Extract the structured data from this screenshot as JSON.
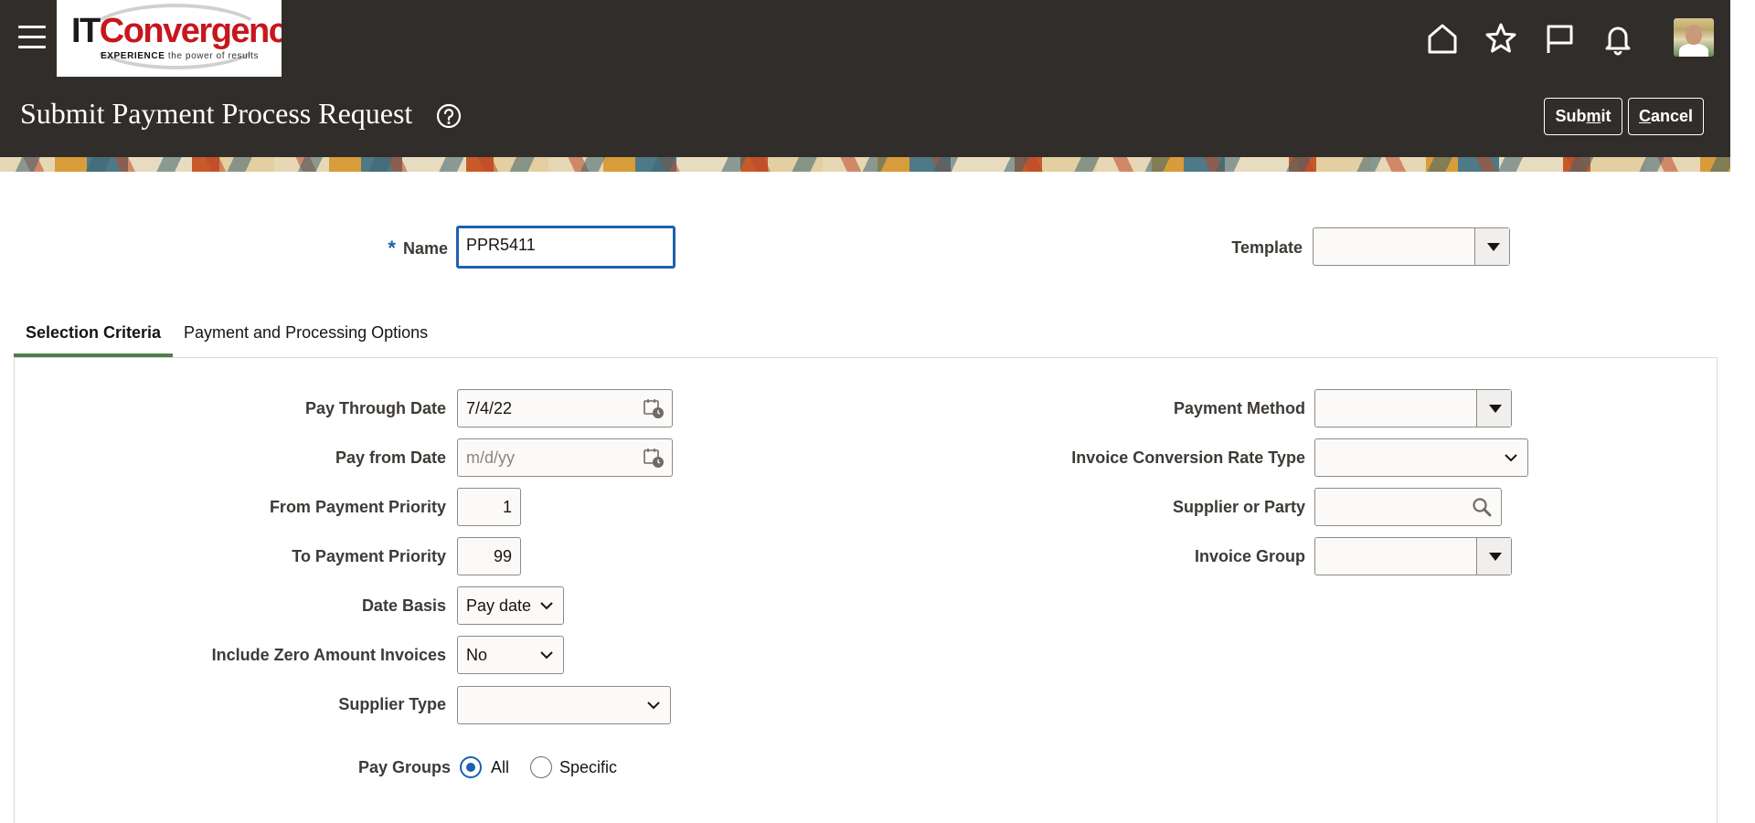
{
  "header": {
    "logo": {
      "brand_it": "IT",
      "brand_rest": "Convergence",
      "tagline_bold": "EXPERIENCE",
      "tagline_rest": " the power of results"
    },
    "icons": [
      "home-icon",
      "favorites-star-icon",
      "flag-icon",
      "notifications-bell-icon"
    ],
    "page_title": "Submit Payment Process Request",
    "buttons": {
      "submit": {
        "pre": "Sub",
        "mnemonic": "m",
        "post": "it"
      },
      "cancel": {
        "pre": "",
        "mnemonic": "C",
        "post": "ancel"
      }
    }
  },
  "form": {
    "name": {
      "required_mark": "*",
      "label": "Name",
      "value": "PPR5411"
    },
    "template": {
      "label": "Template",
      "value": ""
    }
  },
  "tabs": [
    {
      "label": "Selection Criteria",
      "active": true
    },
    {
      "label": "Payment and Processing Options",
      "active": false
    }
  ],
  "selection": {
    "pay_through_date": {
      "label": "Pay Through Date",
      "value": "7/4/22"
    },
    "pay_from_date": {
      "label": "Pay from Date",
      "value": "",
      "placeholder": "m/d/yy"
    },
    "from_priority": {
      "label": "From Payment Priority",
      "value": "1"
    },
    "to_priority": {
      "label": "To Payment Priority",
      "value": "99"
    },
    "date_basis": {
      "label": "Date Basis",
      "value": "Pay date"
    },
    "zero_amount": {
      "label": "Include Zero Amount Invoices",
      "value": "No"
    },
    "supplier_type": {
      "label": "Supplier Type",
      "value": ""
    },
    "pay_groups": {
      "label": "Pay Groups",
      "options": [
        "All",
        "Specific"
      ],
      "selected": "All"
    },
    "payment_method": {
      "label": "Payment Method",
      "value": ""
    },
    "conversion_rate_type": {
      "label": "Invoice Conversion Rate Type",
      "value": ""
    },
    "supplier_or_party": {
      "label": "Supplier or Party",
      "value": ""
    },
    "invoice_group": {
      "label": "Invoice Group",
      "value": ""
    }
  },
  "colors": {
    "header_bg": "#312d2a",
    "focus_blue": "#1c61b3",
    "tab_underline": "#4f7d49",
    "brand_red": "#c8161d"
  }
}
